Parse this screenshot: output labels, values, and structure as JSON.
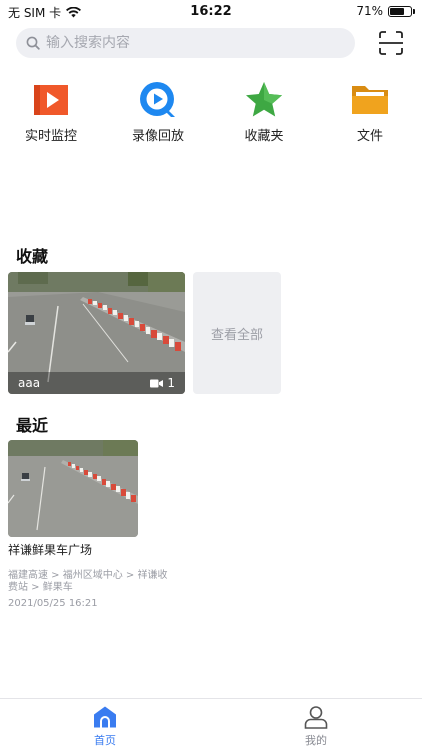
{
  "status_bar": {
    "carrier": "无 SIM 卡",
    "time": "16:22",
    "battery_text": "71%",
    "battery_level": 0.71
  },
  "search": {
    "placeholder": "输入搜索内容"
  },
  "quick_entries": [
    {
      "label": "实时监控",
      "icon": "live-monitor-icon",
      "color": "#f0582a"
    },
    {
      "label": "录像回放",
      "icon": "playback-icon",
      "color": "#1e88f0"
    },
    {
      "label": "收藏夹",
      "icon": "star-icon",
      "color": "#3ea843"
    },
    {
      "label": "文件",
      "icon": "folder-icon",
      "color": "#f0a31e"
    }
  ],
  "favorites": {
    "title": "收藏",
    "items": [
      {
        "name": "aaa",
        "camera_count": "1"
      }
    ],
    "view_all_label": "查看全部"
  },
  "recent": {
    "title": "最近",
    "items": [
      {
        "name": "祥谦鲜果车广场",
        "path": "福建高速 > 福州区域中心 > 祥谦收费站 > 鲜果车",
        "time": "2021/05/25 16:21"
      }
    ]
  },
  "tab_bar": {
    "home_label": "首页",
    "mine_label": "我的",
    "active_color": "#3a7cf0",
    "inactive_color": "#888a92"
  }
}
